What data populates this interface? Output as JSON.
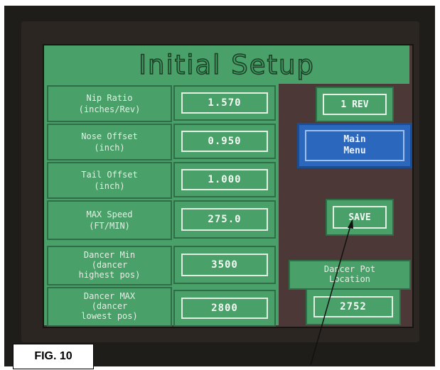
{
  "figure_label": "FIG. 10",
  "screen": {
    "title": "Initial Setup",
    "params": [
      {
        "label_line1": "Nip Ratio",
        "label_line2": "(inches/Rev)",
        "value": "1.570"
      },
      {
        "label_line1": "Nose Offset",
        "label_line2": "(inch)",
        "value": "0.950"
      },
      {
        "label_line1": "Tail Offset",
        "label_line2": "(inch)",
        "value": "1.000"
      },
      {
        "label_line1": "MAX Speed",
        "label_line2": "(FT/MIN)",
        "value": "275.0"
      }
    ],
    "dancer_min": {
      "line1": "Dancer Min",
      "line2": "(dancer",
      "line3": "highest pos)",
      "value": "3500"
    },
    "dancer_max": {
      "line1": "Dancer MAX",
      "line2": "(dancer",
      "line3": "lowest pos)",
      "value": "2800"
    },
    "rev_button": "1 REV",
    "main_menu": {
      "line1": "Main",
      "line2": "Menu"
    },
    "save_button": "SAVE",
    "dancer_pot": {
      "line1": "Dancer Pot",
      "line2": "Location",
      "value": "2752"
    }
  },
  "colors": {
    "panel_green": "#49a069",
    "screen_background": "#4b3837",
    "menu_blue": "#2b67bd"
  }
}
